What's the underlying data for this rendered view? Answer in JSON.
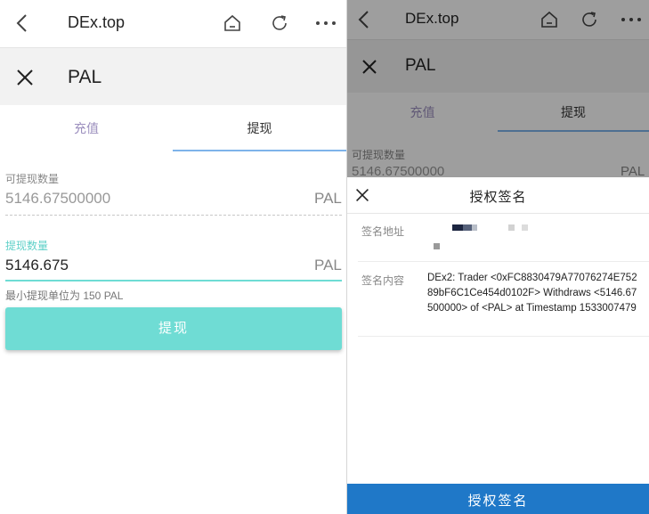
{
  "left": {
    "topbar": {
      "title": "DEx.top",
      "icons": [
        "back-arrow-icon",
        "home-icon",
        "refresh-icon",
        "more-icon"
      ]
    },
    "header": {
      "token": "PAL"
    },
    "tabs": [
      {
        "label": "充值",
        "active": false
      },
      {
        "label": "提现",
        "active": true
      }
    ],
    "available": {
      "label": "可提现数量",
      "value": "5146.67500000",
      "unit": "PAL"
    },
    "amount": {
      "label": "提现数量",
      "value": "5146.675",
      "unit": "PAL"
    },
    "hint": "最小提现单位为 150 PAL",
    "submit_label": "提现"
  },
  "right": {
    "topbar": {
      "title": "DEx.top"
    },
    "header": {
      "token": "PAL"
    },
    "tabs": [
      {
        "label": "充值"
      },
      {
        "label": "提现"
      }
    ],
    "available": {
      "label": "可提现数量",
      "value": "5146.67500000",
      "unit": "PAL"
    },
    "sheet": {
      "title": "授权签名",
      "address_label": "签名地址",
      "content_label": "签名内容",
      "content": "DEx2: Trader <0xFC8830479A77076274E75289bF6C1Ce454d0102F> Withdraws <5146.67500000> of <PAL> at Timestamp 1533007479",
      "confirm_label": "授权签名"
    }
  },
  "colors": {
    "accent_teal": "#6fdcd4",
    "tab_active_line": "#7eb3ea",
    "confirm_blue": "#1f78c8"
  }
}
